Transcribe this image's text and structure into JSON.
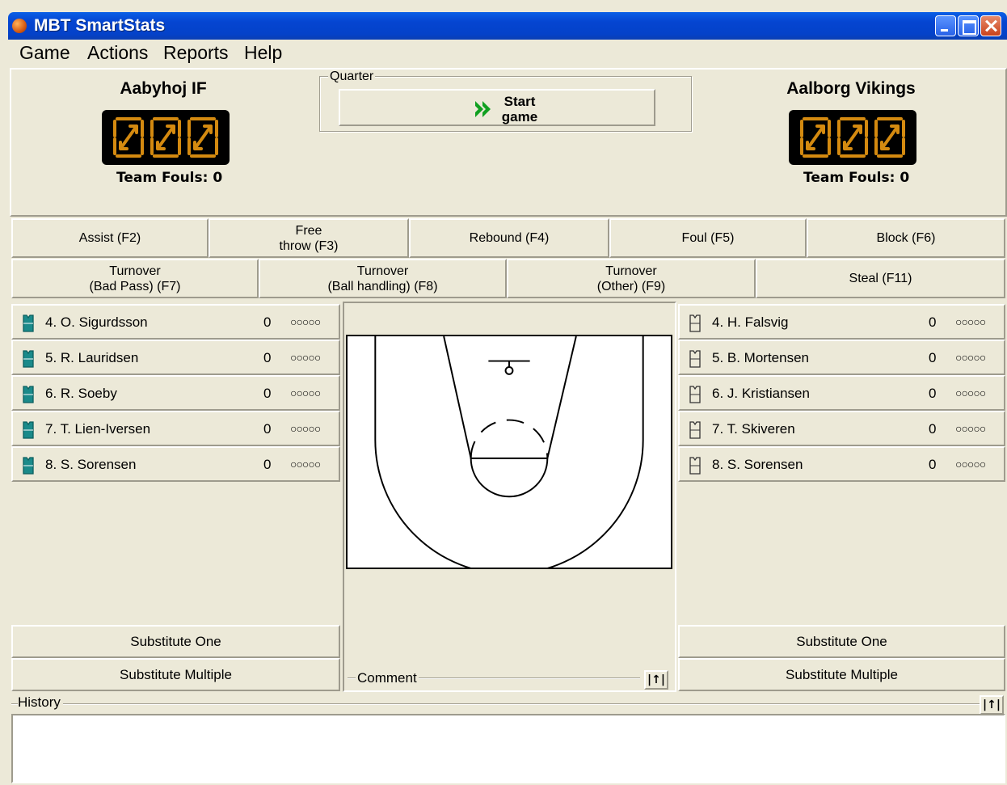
{
  "window": {
    "title": "MBT SmartStats"
  },
  "menu": [
    "Game",
    "Actions",
    "Reports",
    "Help"
  ],
  "home": {
    "name": "Aabyhoj IF",
    "fouls_label": "Team Fouls:",
    "fouls": "0"
  },
  "away": {
    "name": "Aalborg Vikings",
    "fouls_label": "Team Fouls:",
    "fouls": "0"
  },
  "quarter": {
    "label": "Quarter",
    "start_line1": "Start",
    "start_line2": "game"
  },
  "actions_row1": [
    "Assist (F2)",
    "Free\nthrow (F3)",
    "Rebound (F4)",
    "Foul (F5)",
    "Block (F6)"
  ],
  "actions_row2": [
    "Turnover\n(Bad Pass) (F7)",
    "Turnover\n(Ball handling) (F8)",
    "Turnover\n(Other) (F9)",
    "Steal (F11)"
  ],
  "home_players": [
    {
      "name": "4. O. Sigurdsson",
      "points": "0",
      "fouls": "○○○○○"
    },
    {
      "name": "5. R. Lauridsen",
      "points": "0",
      "fouls": "○○○○○"
    },
    {
      "name": "6. R. Soeby",
      "points": "0",
      "fouls": "○○○○○"
    },
    {
      "name": "7. T. Lien-Iversen",
      "points": "0",
      "fouls": "○○○○○"
    },
    {
      "name": "8. S. Sorensen",
      "points": "0",
      "fouls": "○○○○○"
    }
  ],
  "away_players": [
    {
      "name": "4. H. Falsvig",
      "points": "0",
      "fouls": "○○○○○"
    },
    {
      "name": "5. B. Mortensen",
      "points": "0",
      "fouls": "○○○○○"
    },
    {
      "name": "6. J. Kristiansen",
      "points": "0",
      "fouls": "○○○○○"
    },
    {
      "name": "7. T. Skiveren",
      "points": "0",
      "fouls": "○○○○○"
    },
    {
      "name": "8. S. Sorensen",
      "points": "0",
      "fouls": "○○○○○"
    }
  ],
  "substitute": {
    "one": "Substitute One",
    "multiple": "Substitute Multiple"
  },
  "comment": {
    "label": "Comment",
    "expand": "|↑|"
  },
  "history": {
    "label": "History",
    "expand": "|↑|"
  },
  "colors": {
    "home_jersey": "#1a8a8a",
    "digit_amber": "#d48a10",
    "titlebar": "#0545d1"
  }
}
